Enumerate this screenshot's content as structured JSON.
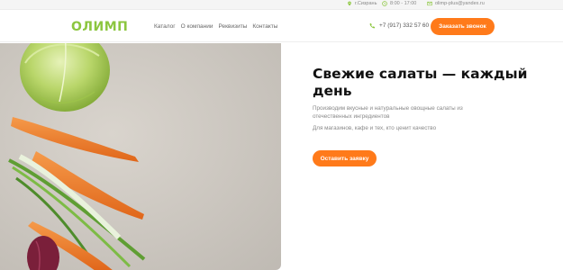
{
  "topbar": {
    "location": "г.Сизрань",
    "hours": "8:00 - 17:00",
    "email": "olimp-plus@yandex.ru"
  },
  "header": {
    "logo": "ОЛИМП",
    "nav": [
      "Каталог",
      "О компании",
      "Реквизиты",
      "Контакты"
    ],
    "phone": "+7 (917) 332 57 60",
    "cta": "Заказать звонок"
  },
  "hero": {
    "title": "Свежие салаты — каждый день",
    "description": "Производим вкусные и натуральные овощные салаты из отечественных ингредиентов",
    "subtext": "Для магазинов, кафе и тех, кто ценит качество",
    "cta": "Оставить заявку"
  },
  "colors": {
    "accent": "#ff7a1a",
    "brand": "#8cc63f"
  },
  "icons": {
    "location": "location-pin-icon",
    "hours": "clock-icon",
    "email": "mail-icon",
    "phone": "phone-icon"
  }
}
